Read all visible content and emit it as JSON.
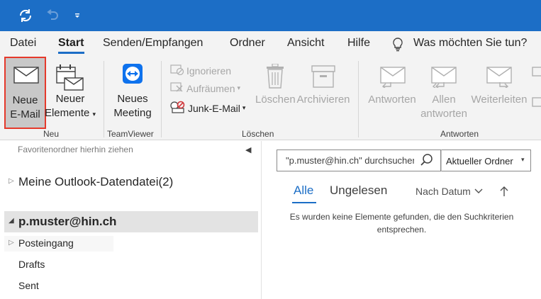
{
  "quick_access": {
    "sync_icon": "sync-icon",
    "undo_icon": "undo-icon",
    "customize_icon": "customize-icon"
  },
  "tabs": {
    "file": "Datei",
    "start": "Start",
    "send_receive": "Senden/Empfangen",
    "folder": "Ordner",
    "view": "Ansicht",
    "help": "Hilfe",
    "tell_me": "Was möchten Sie tun?"
  },
  "ribbon": {
    "new_group": {
      "label": "Neu",
      "new_email_line1": "Neue",
      "new_email_line2": "E-Mail",
      "new_items_line1": "Neuer",
      "new_items_line2": "Elemente"
    },
    "teamviewer_group": {
      "label": "TeamViewer",
      "meeting_line1": "Neues",
      "meeting_line2": "Meeting"
    },
    "delete_group": {
      "label": "Löschen",
      "ignore": "Ignorieren",
      "cleanup": "Aufräumen",
      "junk": "Junk-E-Mail",
      "delete": "Löschen",
      "archive": "Archivieren"
    },
    "respond_group": {
      "label": "Antworten",
      "reply": "Antworten",
      "reply_all_line1": "Allen",
      "reply_all_line2": "antworten",
      "forward": "Weiterleiten"
    }
  },
  "left_pane": {
    "favorites_hint": "Favoritenordner hierhin ziehen",
    "datafile": "Meine Outlook-Datendatei(2)",
    "account": "p.muster@hin.ch",
    "folders": [
      "Posteingang",
      "Drafts",
      "Sent"
    ]
  },
  "right_pane": {
    "search_value": "\"p.muster@hin.ch\" durchsuchen",
    "scope": "Aktueller Ordner",
    "filter_all": "Alle",
    "filter_unread": "Ungelesen",
    "sort_by": "Nach Datum",
    "empty_message_line1": "Es wurden keine Elemente gefunden, die den Suchkriterien",
    "empty_message_line2": "entsprechen."
  },
  "colors": {
    "accent": "#1c6ec6",
    "highlight": "#e5392b",
    "selected_bg": "#c8c8c8"
  }
}
